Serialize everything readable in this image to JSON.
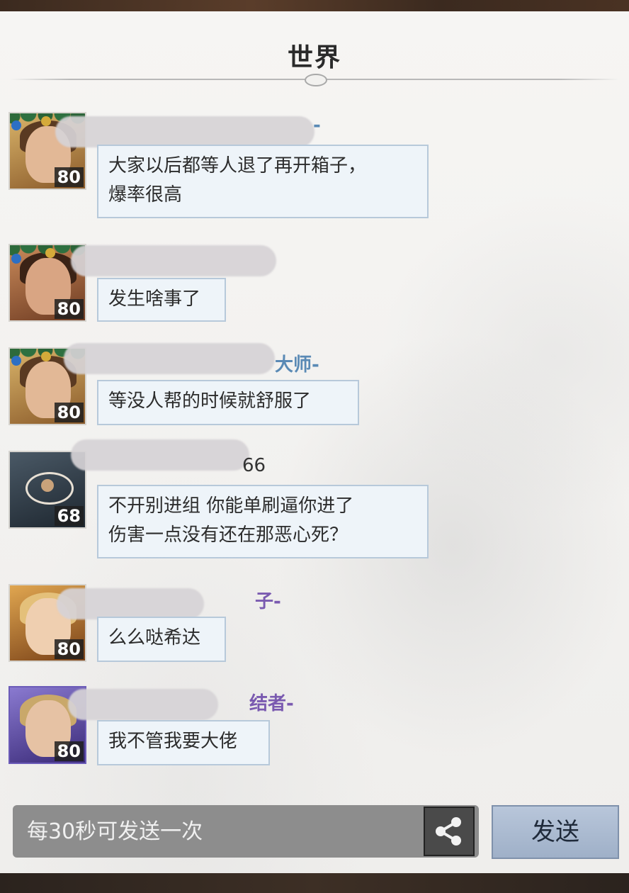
{
  "channel": {
    "title": "世界"
  },
  "messages": [
    {
      "name_tail": "-",
      "level": "80",
      "lines": [
        "大家以后都等人退了再开箱子，",
        "爆率很高"
      ]
    },
    {
      "name_tail": "",
      "level": "80",
      "lines": [
        "发生啥事了"
      ]
    },
    {
      "name_tail": "大师-",
      "level": "80",
      "lines": [
        "等没人帮的时候就舒服了"
      ]
    },
    {
      "name_tail": "66",
      "level": "68",
      "lines": [
        "不开别进组 你能单刷逼你进了",
        "伤害一点没有还在那恶心死？"
      ]
    },
    {
      "name_tail": "子-",
      "level": "80",
      "lines": [
        "么么哒希达"
      ]
    },
    {
      "name_tail": "结者-",
      "level": "80",
      "lines": [
        "我不管我要大佬"
      ]
    }
  ],
  "composer": {
    "placeholder": "每30秒可发送一次",
    "send_label": "发送",
    "share_icon": "share-icon"
  }
}
